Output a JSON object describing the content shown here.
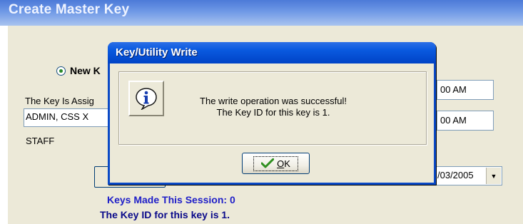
{
  "window": {
    "title": "Create Master Key",
    "radio_label": "New K",
    "assigned_label": "The Key Is Assig",
    "assigned_value": "ADMIN, CSS X",
    "staff_text": "STAFF",
    "time1": "00 AM",
    "time2": "00 AM",
    "date_value": "/03/2005",
    "keys_made": "Keys Made This Session: 0",
    "key_id_line": "The Key ID for this key is 1."
  },
  "dialog": {
    "title": "Key/Utility Write",
    "message_line1": "The write operation was successful!",
    "message_line2": "The Key ID for this key is 1.",
    "ok_label": "OK",
    "icon": "info-icon",
    "ok_icon": "checkmark-icon"
  },
  "colors": {
    "titlebar": "#0a49c6",
    "dialog_face": "#ece9d8",
    "session_text": "#1e1ec8",
    "check_green": "#2f8f1f"
  }
}
